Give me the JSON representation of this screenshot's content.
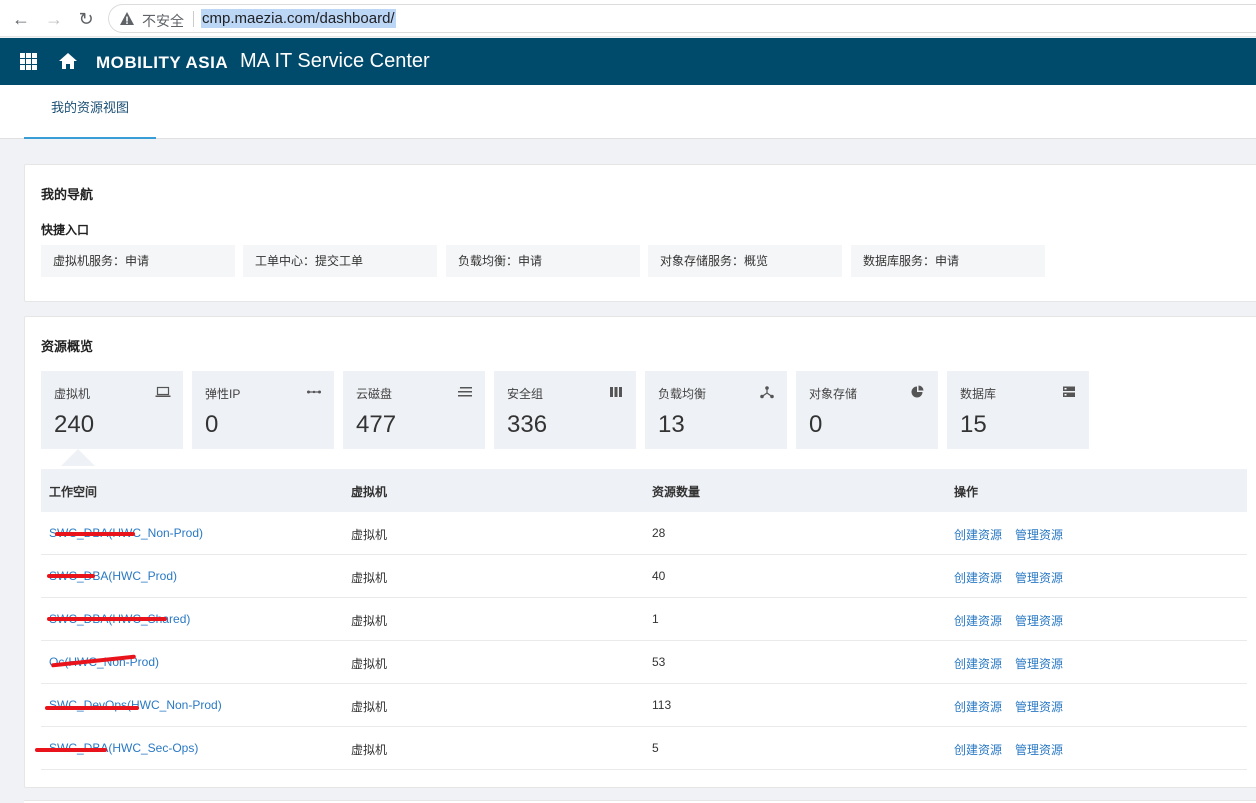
{
  "browser": {
    "insecure_label": "不安全",
    "url": "cmp.maezia.com/dashboard/"
  },
  "header": {
    "brand": "MOBILITY ASIA",
    "title": "MA IT Service Center"
  },
  "tabs": [
    {
      "label": "我的资源视图",
      "active": true
    }
  ],
  "nav_card": {
    "title": "我的导航",
    "subtitle": "快捷入口",
    "links": [
      {
        "label": "虚拟机服务：申请"
      },
      {
        "label": "工单中心：提交工单"
      },
      {
        "label": "负载均衡：申请"
      },
      {
        "label": "对象存储服务：概览"
      },
      {
        "label": "数据库服务：申请"
      }
    ]
  },
  "resources": {
    "title": "资源概览",
    "stats": [
      {
        "label": "虚拟机",
        "value": "240",
        "icon": "laptop-icon"
      },
      {
        "label": "弹性IP",
        "value": "0",
        "icon": "link-icon"
      },
      {
        "label": "云磁盘",
        "value": "477",
        "icon": "list-icon"
      },
      {
        "label": "安全组",
        "value": "336",
        "icon": "columns-icon"
      },
      {
        "label": "负载均衡",
        "value": "13",
        "icon": "share-icon"
      },
      {
        "label": "对象存储",
        "value": "0",
        "icon": "pie-icon"
      },
      {
        "label": "数据库",
        "value": "15",
        "icon": "server-icon"
      }
    ],
    "table": {
      "headers": [
        "工作空间",
        "虚拟机",
        "资源数量",
        "操作"
      ],
      "rows": [
        {
          "workspace": "SWC_DBA(HWC_Non-Prod)",
          "type": "虚拟机",
          "count": "28",
          "create": "创建资源",
          "manage": "管理资源"
        },
        {
          "workspace": "SWC_DBA(HWC_Prod)",
          "type": "虚拟机",
          "count": "40",
          "create": "创建资源",
          "manage": "管理资源"
        },
        {
          "workspace": "SWC_DBA(HWC_Shared)",
          "type": "虚拟机",
          "count": "1",
          "create": "创建资源",
          "manage": "管理资源"
        },
        {
          "workspace": "Oc(HWC_Non-Prod)",
          "type": "虚拟机",
          "count": "53",
          "create": "创建资源",
          "manage": "管理资源"
        },
        {
          "workspace": "SWC_DevOps(HWC_Non-Prod)",
          "type": "虚拟机",
          "count": "113",
          "create": "创建资源",
          "manage": "管理资源"
        },
        {
          "workspace": "SWC_DBA(HWC_Sec-Ops)",
          "type": "虚拟机",
          "count": "5",
          "create": "创建资源",
          "manage": "管理资源"
        }
      ]
    }
  }
}
